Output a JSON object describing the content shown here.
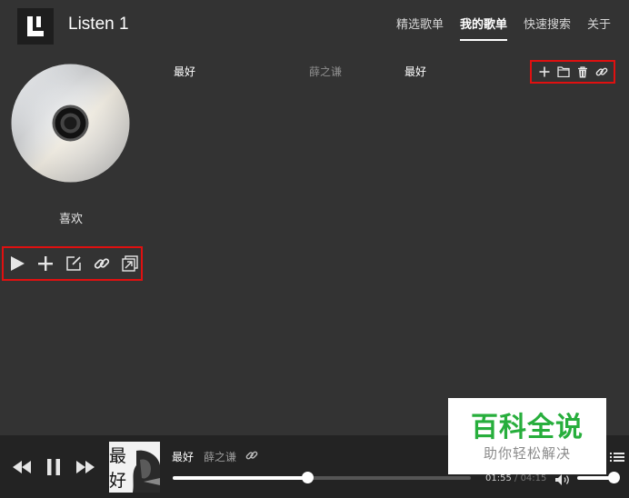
{
  "app": {
    "title": "Listen 1",
    "logo_icon": "listen1-logo"
  },
  "nav": {
    "items": [
      {
        "label": "精选歌单",
        "active": false
      },
      {
        "label": "我的歌单",
        "active": true
      },
      {
        "label": "快速搜索",
        "active": false
      },
      {
        "label": "关于",
        "active": false
      }
    ]
  },
  "playlist": {
    "name": "喜欢",
    "cover_icon": "cd-disc-icon",
    "actions": [
      "play-icon",
      "plus-icon",
      "edit-icon",
      "link-icon",
      "export-icon"
    ]
  },
  "songs": [
    {
      "title": "最好",
      "artist": "薛之谦",
      "album": "最好",
      "actions": [
        "plus-icon",
        "folder-icon",
        "trash-icon",
        "link-icon"
      ]
    }
  ],
  "player": {
    "title": "最好",
    "artist": "薛之谦",
    "album_art_text": [
      "最",
      "好"
    ],
    "current_time": "01:55",
    "separator": " / ",
    "total_time": "04:15",
    "progress": 0.45,
    "volume": 0.92
  },
  "watermark": {
    "main": "百科全说",
    "sub": "助你轻松解决"
  },
  "colors": {
    "background": "#333333",
    "player_bg": "#232323",
    "highlight_border": "#e01010",
    "watermark_green": "#27ae3c"
  }
}
